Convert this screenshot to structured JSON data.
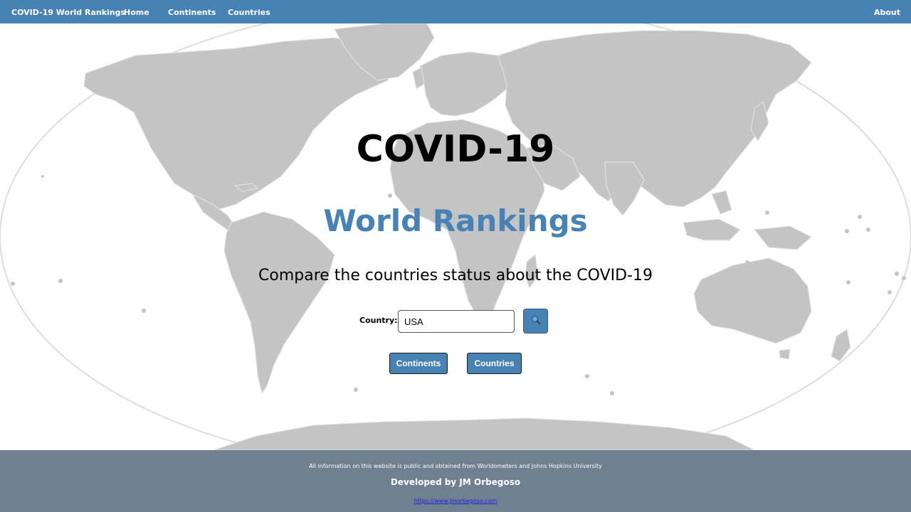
{
  "nav": {
    "brand": "COVID-19 World Rankings",
    "home": "Home",
    "continents": "Continents",
    "countries": "Countries",
    "about": "About"
  },
  "hero": {
    "title": "COVID-19",
    "subtitle": "World Rankings",
    "tagline": "Compare the countries status about the COVID-19"
  },
  "search": {
    "label": "Country:",
    "value": "USA",
    "button_icon": "search-icon"
  },
  "actions": {
    "continents_label": "Continents",
    "countries_label": "Countries"
  },
  "footer": {
    "info": "All information on this website is public and obtained from Worldometers and Johns Hopkins University",
    "developer": "Developed by JM Orbegoso",
    "link": "https://www.jmorbegoso.com"
  },
  "colors": {
    "primary": "#4682b4",
    "footer_bg": "#708090",
    "map_land": "#c4c4c4",
    "title": "#000000"
  }
}
